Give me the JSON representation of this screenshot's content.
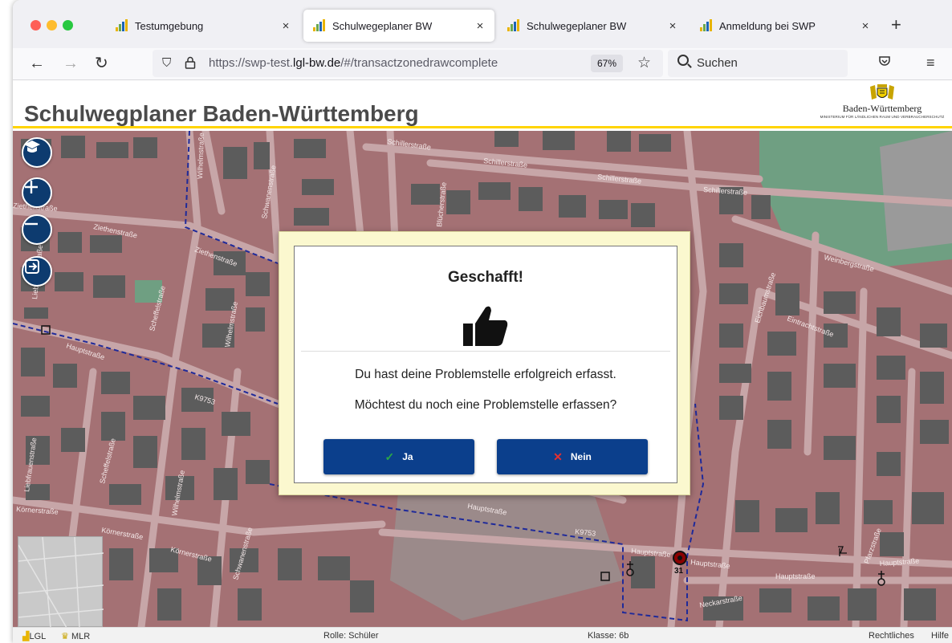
{
  "browser": {
    "tabs": [
      {
        "label": "Testumgebung",
        "close": "×"
      },
      {
        "label": "Schulwegeplaner BW",
        "close": "×"
      },
      {
        "label": "Schulwegeplaner BW",
        "close": "×"
      },
      {
        "label": "Anmeldung bei SWP",
        "close": "×"
      }
    ],
    "new_tab": "+",
    "url_prefix": "https://swp-test.",
    "url_domain": "lgl-bw.de",
    "url_suffix": "/#/transactzonedrawcomplete",
    "zoom": "67%",
    "search_placeholder": "Suchen"
  },
  "app": {
    "title": "Schulwegplaner Baden-Württemberg",
    "logo_name": "Baden-Württemberg",
    "logo_sub": "MINISTERIUM FÜR LÄNDLICHEN RAUM UND VERBRAUCHERSCHUTZ"
  },
  "map": {
    "street_labels": [
      "Schillerstraße",
      "Schillerstraße",
      "Schillerstraße",
      "Schillerstraße",
      "Ziethenstraße",
      "Ziethenstraße",
      "Ziethenstraße",
      "Wilhelmstraße",
      "Wilhelmstraße",
      "Wilhelmstraße",
      "Liebfrauenstraße",
      "Liebfrauenstraße",
      "Scheffelstraße",
      "Scheffelstraße",
      "Hauptstraße",
      "Hauptstraße",
      "Hauptstraße",
      "Hauptstraße",
      "Hauptstraße",
      "Hauptstraße",
      "Körnerstraße",
      "Körnerstraße",
      "Körnerstraße",
      "Schwanenstraße",
      "Schwanenstraße",
      "Blücherstraße",
      "Weinbergstraße",
      "Eintrachtstraße",
      "Eichbaumstraße",
      "Neckarstraße",
      "Pfarzstraße",
      "K9753",
      "K9753"
    ],
    "marker_label": "31"
  },
  "dialog": {
    "title": "Geschafft!",
    "message1": "Du hast deine Problemstelle erfolgreich erfasst.",
    "message2": "Möchtest du noch eine Problemstelle erfassen?",
    "yes_label": "Ja",
    "no_label": "Nein"
  },
  "footer": {
    "lgl": "LGL",
    "mlr": "MLR",
    "rolle": "Rolle: Schüler",
    "klasse": "Klasse: 6b",
    "rechtliches": "Rechtliches",
    "hilfe": "Hilfe"
  },
  "colors": {
    "map_base": "#a47174",
    "buildings": "#5c5c5c",
    "control_blue": "#0d3b6f",
    "button_blue": "#0b3f8c",
    "dialog_frame": "#fbf8cf",
    "header_accent": "#ffd400"
  }
}
